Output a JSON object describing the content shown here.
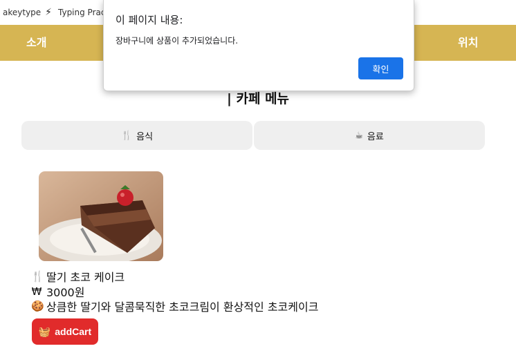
{
  "bookmarks": [
    {
      "label": "akeytype",
      "icon": "monkeytype-icon"
    },
    {
      "label": "Typing Pract",
      "icon": "lightning-icon"
    }
  ],
  "nav": {
    "intro_label": "소개",
    "location_label": "위치",
    "color": "#d6b553"
  },
  "page": {
    "menu_title": "| 카페 메뉴"
  },
  "tabs": [
    {
      "label": "음식",
      "icon": "fork-knife-icon"
    },
    {
      "label": "음료",
      "icon": "coffee-cup-icon"
    }
  ],
  "item": {
    "image": "chocolate-cake-with-strawberry",
    "name": "딸기 초코 케이크",
    "price": "3000원",
    "description": "상큼한 딸기와 달콤묵직한 초코크림이 환상적인 초코케이크",
    "button_label": "addCart",
    "button_color": "#e12b2b"
  },
  "dialog": {
    "title": "이 페이지 내용:",
    "message": "장바구니에 상품이 추가되었습니다.",
    "ok_label": "확인",
    "ok_color": "#1a73e8"
  }
}
